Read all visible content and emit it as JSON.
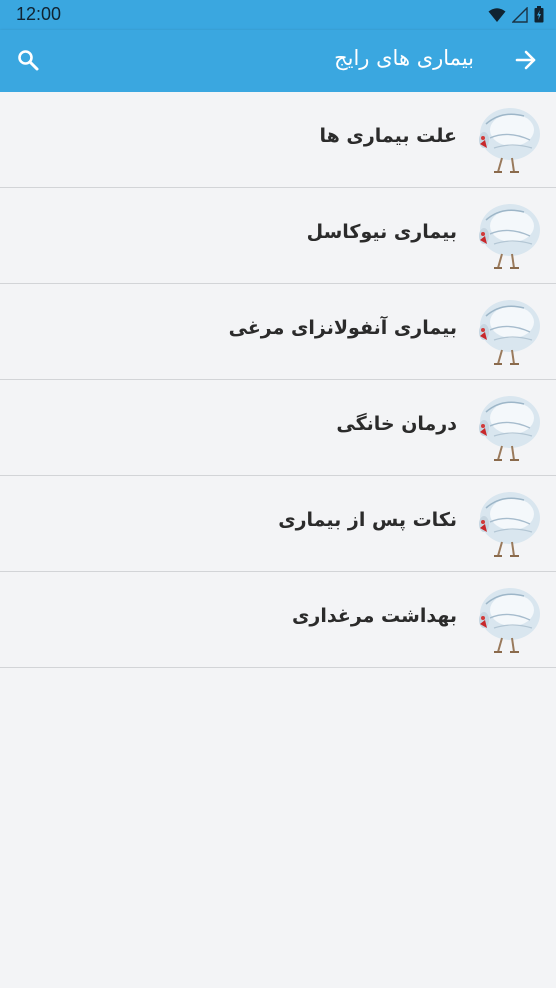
{
  "status_bar": {
    "time": "12:00",
    "icons": [
      "wifi-icon",
      "cellular-signal-icon",
      "battery-icon"
    ]
  },
  "app_bar": {
    "title": "بیماری های رایج",
    "back_icon": "arrow-right-icon",
    "search_icon": "search-icon",
    "background_color": "#3aa7e0"
  },
  "list": {
    "items": [
      {
        "label": "علت بیماری ها",
        "icon": "chicken-thumbnail"
      },
      {
        "label": "بیماری نیوکاسل",
        "icon": "chicken-thumbnail"
      },
      {
        "label": "بیماری آنفولانزای مرغی",
        "icon": "chicken-thumbnail"
      },
      {
        "label": "درمان خانگی",
        "icon": "chicken-thumbnail"
      },
      {
        "label": "نکات پس از بیماری",
        "icon": "chicken-thumbnail"
      },
      {
        "label": "بهداشت مرغداری",
        "icon": "chicken-thumbnail"
      }
    ]
  }
}
